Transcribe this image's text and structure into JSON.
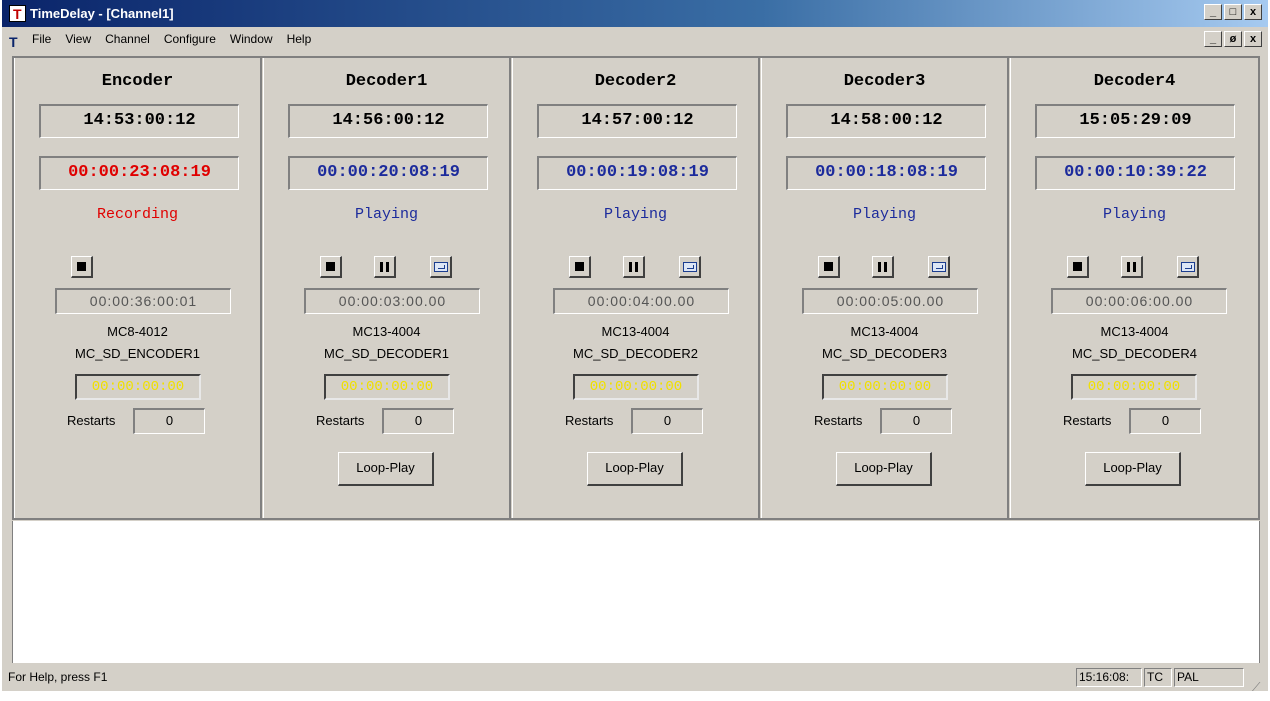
{
  "window": {
    "title": "TimeDelay - [Channel1]",
    "app_icon_letter": "T",
    "buttons": [
      "_",
      "□",
      "x"
    ],
    "mdi_buttons": [
      "_",
      "ø",
      "x"
    ]
  },
  "menu": {
    "items": [
      "File",
      "View",
      "Channel",
      "Configure",
      "Window",
      "Help"
    ]
  },
  "channels": [
    {
      "name": "Encoder",
      "time": "14:53:00:12",
      "counter": "00:00:23:08:19",
      "counter_color": "#e00000",
      "state": "Recording",
      "state_color": "#e00000",
      "controls": [
        "stop"
      ],
      "delay": "00:00:36:00:01",
      "device_model": "MC8-4012",
      "device_name": "MC_SD_ENCODER1",
      "yellow_time": "00:00:00:00",
      "restarts_label": "Restarts",
      "restarts": "0",
      "loop_play": null
    },
    {
      "name": "Decoder1",
      "time": "14:56:00:12",
      "counter": "00:00:20:08:19",
      "counter_color": "#1c2b9c",
      "state": "Playing",
      "state_color": "#1c2b9c",
      "controls": [
        "stop",
        "pause",
        "loop"
      ],
      "delay": "00:00:03:00.00",
      "device_model": "MC13-4004",
      "device_name": "MC_SD_DECODER1",
      "yellow_time": "00:00:00:00",
      "restarts_label": "Restarts",
      "restarts": "0",
      "loop_play": "Loop-Play"
    },
    {
      "name": "Decoder2",
      "time": "14:57:00:12",
      "counter": "00:00:19:08:19",
      "counter_color": "#1c2b9c",
      "state": "Playing",
      "state_color": "#1c2b9c",
      "controls": [
        "stop",
        "pause",
        "loop"
      ],
      "delay": "00:00:04:00.00",
      "device_model": "MC13-4004",
      "device_name": "MC_SD_DECODER2",
      "yellow_time": "00:00:00:00",
      "restarts_label": "Restarts",
      "restarts": "0",
      "loop_play": "Loop-Play"
    },
    {
      "name": "Decoder3",
      "time": "14:58:00:12",
      "counter": "00:00:18:08:19",
      "counter_color": "#1c2b9c",
      "state": "Playing",
      "state_color": "#1c2b9c",
      "controls": [
        "stop",
        "pause",
        "loop"
      ],
      "delay": "00:00:05:00.00",
      "device_model": "MC13-4004",
      "device_name": "MC_SD_DECODER3",
      "yellow_time": "00:00:00:00",
      "restarts_label": "Restarts",
      "restarts": "0",
      "loop_play": "Loop-Play"
    },
    {
      "name": "Decoder4",
      "time": "15:05:29:09",
      "counter": "00:00:10:39:22",
      "counter_color": "#1c2b9c",
      "state": "Playing",
      "state_color": "#1c2b9c",
      "controls": [
        "stop",
        "pause",
        "loop"
      ],
      "delay": "00:00:06:00.00",
      "device_model": "MC13-4004",
      "device_name": "MC_SD_DECODER4",
      "yellow_time": "00:00:00:00",
      "restarts_label": "Restarts",
      "restarts": "0",
      "loop_play": "Loop-Play"
    }
  ],
  "status": {
    "help": "For Help, press F1",
    "time": "15:16:08:",
    "tc": "TC",
    "format": "PAL"
  }
}
